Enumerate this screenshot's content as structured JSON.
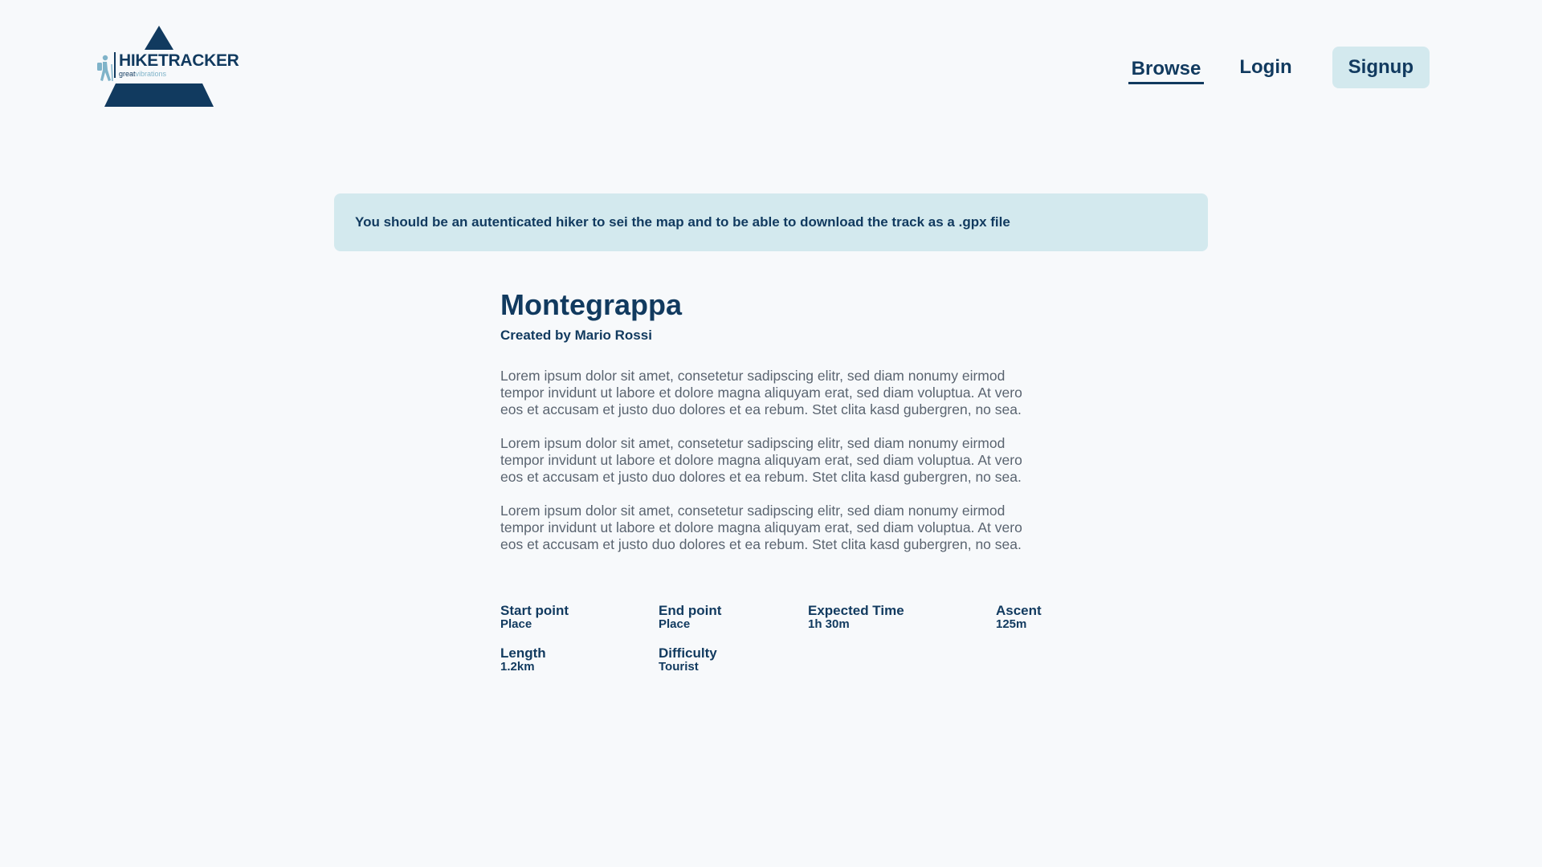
{
  "brand": {
    "name": "HIKETRACKER",
    "tagline_bold": "great",
    "tagline_light": "vibrations",
    "logo_icon": "hiker-icon",
    "colors": {
      "primary": "#113a5f",
      "accent_light": "#d3e9ee",
      "tagline_light": "#7fb3c9",
      "background": "#f7f9fb",
      "body_text": "#5a6470"
    }
  },
  "nav": {
    "browse_label": "Browse",
    "login_label": "Login",
    "signup_label": "Signup",
    "active": "Browse"
  },
  "alert": {
    "message": "You should be an autenticated hiker to sei the map and to be able to download the track as a .gpx file"
  },
  "hike": {
    "title": "Montegrappa",
    "created_by": "Created by Mario Rossi",
    "paragraphs": [
      "Lorem ipsum dolor sit amet, consetetur sadipscing elitr, sed diam nonumy eirmod tempor invidunt ut labore et dolore magna aliquyam erat, sed diam voluptua. At vero eos et accusam et justo duo dolores et ea rebum. Stet clita kasd gubergren, no sea.",
      "Lorem ipsum dolor sit amet, consetetur sadipscing elitr, sed diam nonumy eirmod tempor invidunt ut labore et dolore magna aliquyam erat, sed diam voluptua. At vero eos et accusam et justo duo dolores et ea rebum. Stet clita kasd gubergren, no sea.",
      "Lorem ipsum dolor sit amet, consetetur sadipscing elitr, sed diam nonumy eirmod tempor invidunt ut labore et dolore magna aliquyam erat, sed diam voluptua. At vero eos et accusam et justo duo dolores et ea rebum. Stet clita kasd gubergren, no sea."
    ],
    "stats": [
      {
        "label": "Start point",
        "value": "Place"
      },
      {
        "label": "End point",
        "value": "Place"
      },
      {
        "label": "Expected Time",
        "value": "1h 30m"
      },
      {
        "label": "Ascent",
        "value": "125m"
      },
      {
        "label": "Length",
        "value": "1.2km"
      },
      {
        "label": "Difficulty",
        "value": "Tourist"
      }
    ]
  }
}
